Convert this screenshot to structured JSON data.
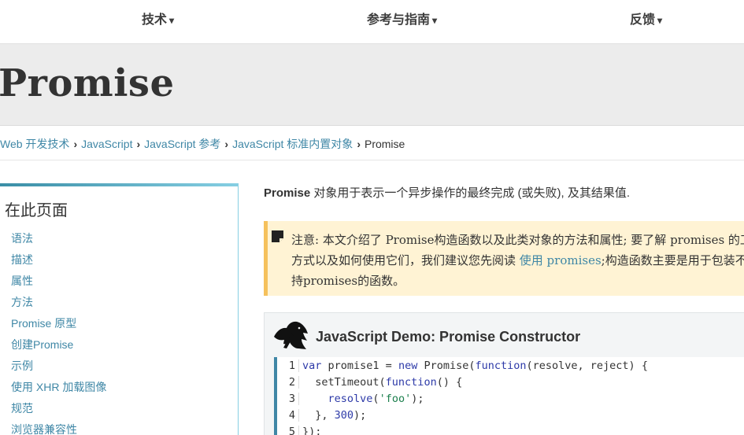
{
  "topnav": {
    "items": [
      {
        "label": "技术",
        "caret": "▾"
      },
      {
        "label": "参考与指南",
        "caret": "▾"
      },
      {
        "label": "反馈",
        "caret": "▾"
      }
    ]
  },
  "page": {
    "title": "Promise"
  },
  "breadcrumb": {
    "links": [
      "Web 开发技术",
      "JavaScript",
      "JavaScript 参考",
      "JavaScript 标准内置对象"
    ],
    "separator": "›",
    "current": "Promise"
  },
  "toc": {
    "heading": "在此页面",
    "items": [
      "语法",
      "描述",
      "属性",
      "方法",
      "Promise 原型",
      "创建Promise",
      "示例",
      "使用 XHR 加载图像",
      "规范",
      "浏览器兼容性"
    ]
  },
  "intro": {
    "term": "Promise",
    "text": " 对象用于表示一个异步操作的最终完成 (或失败), 及其结果值."
  },
  "note": {
    "icon": "note-icon",
    "text_before": "注意: 本文介绍了 Promise构造函数以及此类对象的方法和属性; 要了解 promises 的工作方式以及如何使用它们，我们建议您先阅读 ",
    "link": "使用 promises",
    "text_after": ";构造函数主要是用于包装不支持promises的函数。"
  },
  "demo": {
    "logo": "dinosaur-logo-icon",
    "title": "JavaScript Demo: Promise Constructor",
    "code": {
      "line_numbers": [
        "1",
        "2",
        "3",
        "4",
        "5"
      ],
      "l1": [
        "var",
        " promise1 = ",
        "new",
        " Promise(",
        "function",
        "(resolve, reject) {"
      ],
      "l2": [
        "  setTimeout(",
        "function",
        "() {"
      ],
      "l3": [
        "    ",
        "resolve",
        "(",
        "'foo'",
        ");"
      ],
      "l4": [
        "  }, ",
        "300",
        ");"
      ],
      "l5": [
        "});"
      ]
    }
  },
  "colors": {
    "link": "#3f87a6",
    "note_bg": "#fff3d4",
    "note_border": "#f5c15c",
    "titlebar_bg": "#ececec"
  }
}
